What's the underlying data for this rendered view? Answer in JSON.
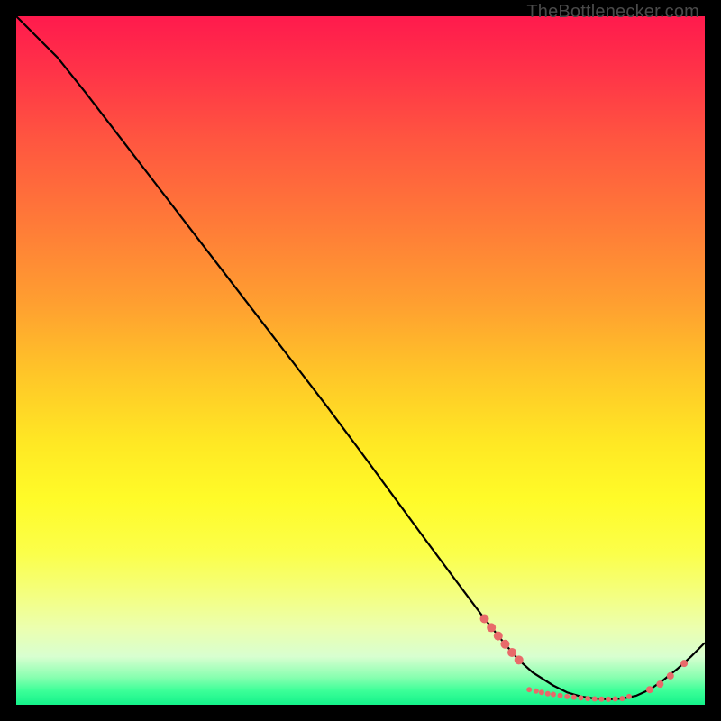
{
  "attribution": "TheBottlenecker.com",
  "colors": {
    "frame": "#000000",
    "gradient_top": "#ff1a4d",
    "gradient_bottom": "#14f28a",
    "curve": "#000000",
    "marker": "#e86a6a"
  },
  "chart_data": {
    "type": "line",
    "title": "",
    "xlabel": "",
    "ylabel": "",
    "xlim": [
      0,
      100
    ],
    "ylim": [
      0,
      100
    ],
    "grid": false,
    "legend": false,
    "series": [
      {
        "name": "bottleneck-curve",
        "x": [
          0,
          6,
          10,
          15,
          20,
          25,
          30,
          35,
          40,
          45,
          50,
          55,
          60,
          65,
          68,
          71,
          73,
          75,
          78,
          80,
          82,
          84,
          86,
          88,
          90,
          92,
          94,
          96,
          98,
          100
        ],
        "values": [
          100,
          94,
          89,
          82.5,
          76,
          69.5,
          63,
          56.5,
          50,
          43.5,
          36.8,
          30,
          23.2,
          16.5,
          12.5,
          8.8,
          6.5,
          4.7,
          2.8,
          1.8,
          1.2,
          0.9,
          0.8,
          0.9,
          1.3,
          2.2,
          3.6,
          5.2,
          7.0,
          9.0
        ]
      }
    ],
    "markers": {
      "name": "highlight-points",
      "points": [
        {
          "x": 68.0,
          "y": 12.5,
          "size": 5
        },
        {
          "x": 69.0,
          "y": 11.2,
          "size": 5
        },
        {
          "x": 70.0,
          "y": 10.0,
          "size": 5
        },
        {
          "x": 71.0,
          "y": 8.8,
          "size": 5
        },
        {
          "x": 72.0,
          "y": 7.6,
          "size": 5
        },
        {
          "x": 73.0,
          "y": 6.5,
          "size": 5
        },
        {
          "x": 74.5,
          "y": 2.2,
          "size": 3
        },
        {
          "x": 75.5,
          "y": 2.0,
          "size": 3
        },
        {
          "x": 76.3,
          "y": 1.8,
          "size": 3
        },
        {
          "x": 77.2,
          "y": 1.6,
          "size": 3
        },
        {
          "x": 78.0,
          "y": 1.5,
          "size": 3
        },
        {
          "x": 79.0,
          "y": 1.35,
          "size": 3
        },
        {
          "x": 80.0,
          "y": 1.2,
          "size": 3
        },
        {
          "x": 81.0,
          "y": 1.1,
          "size": 3
        },
        {
          "x": 82.0,
          "y": 1.0,
          "size": 3
        },
        {
          "x": 83.0,
          "y": 0.9,
          "size": 3
        },
        {
          "x": 84.0,
          "y": 0.85,
          "size": 3
        },
        {
          "x": 85.0,
          "y": 0.82,
          "size": 3
        },
        {
          "x": 86.0,
          "y": 0.8,
          "size": 3
        },
        {
          "x": 87.0,
          "y": 0.85,
          "size": 3
        },
        {
          "x": 88.0,
          "y": 0.9,
          "size": 3
        },
        {
          "x": 89.0,
          "y": 1.2,
          "size": 3
        },
        {
          "x": 92.0,
          "y": 2.2,
          "size": 4
        },
        {
          "x": 93.5,
          "y": 3.0,
          "size": 4
        },
        {
          "x": 95.0,
          "y": 4.2,
          "size": 4
        },
        {
          "x": 97.0,
          "y": 6.0,
          "size": 4
        }
      ]
    }
  }
}
